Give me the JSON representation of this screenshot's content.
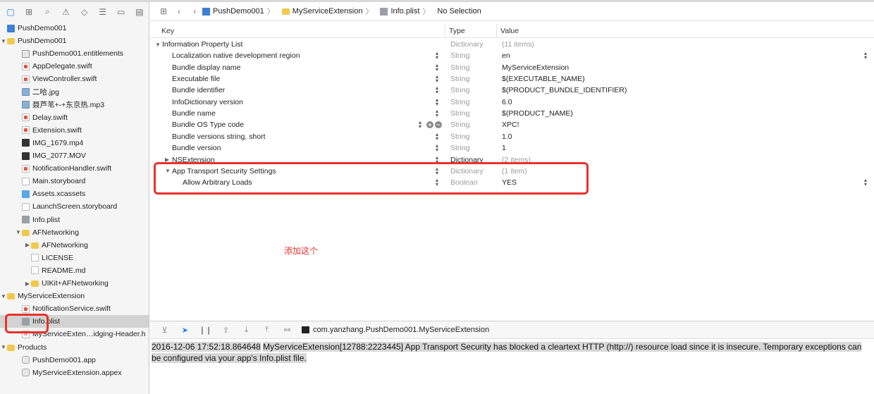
{
  "sidebar": {
    "items": [
      {
        "label": "PushDemo001",
        "icon": "project-icon",
        "depth": 0,
        "disclosure": ""
      },
      {
        "label": "PushDemo001",
        "icon": "folder-icon",
        "depth": 0,
        "disclosure": "▼"
      },
      {
        "label": "PushDemo001.entitlements",
        "icon": "entitlements-icon",
        "depth": 1,
        "disclosure": ""
      },
      {
        "label": "AppDelegate.swift",
        "icon": "swift-file-icon",
        "depth": 1,
        "disclosure": ""
      },
      {
        "label": "ViewController.swift",
        "icon": "swift-file-icon",
        "depth": 1,
        "disclosure": ""
      },
      {
        "label": "二哈.jpg",
        "icon": "image-file-icon",
        "depth": 1,
        "disclosure": ""
      },
      {
        "label": "聂芦苇+-+东京热.mp3",
        "icon": "audio-file-icon",
        "depth": 1,
        "disclosure": ""
      },
      {
        "label": "Delay.swift",
        "icon": "swift-file-icon",
        "depth": 1,
        "disclosure": ""
      },
      {
        "label": "Extension.swift",
        "icon": "swift-file-icon",
        "depth": 1,
        "disclosure": ""
      },
      {
        "label": "IMG_1679.mp4",
        "icon": "video-file-icon",
        "depth": 1,
        "disclosure": ""
      },
      {
        "label": "IMG_2077.MOV",
        "icon": "video-file-icon",
        "depth": 1,
        "disclosure": ""
      },
      {
        "label": "NotificationHandler.swift",
        "icon": "swift-file-icon",
        "depth": 1,
        "disclosure": ""
      },
      {
        "label": "Main.storyboard",
        "icon": "storyboard-icon",
        "depth": 1,
        "disclosure": ""
      },
      {
        "label": "Assets.xcassets",
        "icon": "assets-icon",
        "depth": 1,
        "disclosure": ""
      },
      {
        "label": "LaunchScreen.storyboard",
        "icon": "storyboard-icon",
        "depth": 1,
        "disclosure": ""
      },
      {
        "label": "Info.plist",
        "icon": "plist-icon",
        "depth": 1,
        "disclosure": ""
      },
      {
        "label": "AFNetworking",
        "icon": "folder-icon",
        "depth": 1,
        "disclosure": "▼"
      },
      {
        "label": "AFNetworking",
        "icon": "folder-icon",
        "depth": 2,
        "disclosure": "▶"
      },
      {
        "label": "LICENSE",
        "icon": "document-icon",
        "depth": 2,
        "disclosure": ""
      },
      {
        "label": "README.md",
        "icon": "document-icon",
        "depth": 2,
        "disclosure": ""
      },
      {
        "label": "UIKit+AFNetworking",
        "icon": "folder-icon",
        "depth": 2,
        "disclosure": "▶"
      },
      {
        "label": "MyServiceExtension",
        "icon": "folder-icon",
        "depth": 0,
        "disclosure": "▼"
      },
      {
        "label": "NotificationService.swift",
        "icon": "swift-file-icon",
        "depth": 1,
        "disclosure": ""
      },
      {
        "label": "Info.plist",
        "icon": "plist-icon",
        "depth": 1,
        "disclosure": "",
        "selected": true
      },
      {
        "label": "MyServiceExten…idging-Header.h",
        "icon": "header-file-icon",
        "depth": 1,
        "disclosure": ""
      },
      {
        "label": "Products",
        "icon": "folder-icon",
        "depth": 0,
        "disclosure": "▼"
      },
      {
        "label": "PushDemo001.app",
        "icon": "app-icon",
        "depth": 1,
        "disclosure": ""
      },
      {
        "label": "MyServiceExtension.appex",
        "icon": "appex-icon",
        "depth": 1,
        "disclosure": ""
      }
    ]
  },
  "jumpbar": {
    "crumbs": [
      "PushDemo001",
      "MyServiceExtension",
      "Info.plist",
      "No Selection"
    ]
  },
  "plist": {
    "headers": {
      "key": "Key",
      "type": "Type",
      "value": "Value"
    },
    "rows": [
      {
        "key": "Information Property List",
        "type": "Dictionary",
        "value": "(11 items)",
        "depth": 0,
        "disclosure": "▼",
        "value_grey": true,
        "type_dark": false
      },
      {
        "key": "Localization native development region",
        "type": "String",
        "value": "en",
        "depth": 1,
        "disclosure": "",
        "value_grey": false,
        "type_dark": false
      },
      {
        "key": "Bundle display name",
        "type": "String",
        "value": "MyServiceExtension",
        "depth": 1,
        "disclosure": "",
        "value_grey": false,
        "type_dark": false
      },
      {
        "key": "Executable file",
        "type": "String",
        "value": "$(EXECUTABLE_NAME)",
        "depth": 1,
        "disclosure": "",
        "value_grey": false,
        "type_dark": false
      },
      {
        "key": "Bundle identifier",
        "type": "String",
        "value": "$(PRODUCT_BUNDLE_IDENTIFIER)",
        "depth": 1,
        "disclosure": "",
        "value_grey": false,
        "type_dark": false
      },
      {
        "key": "InfoDictionary version",
        "type": "String",
        "value": "6.0",
        "depth": 1,
        "disclosure": "",
        "value_grey": false,
        "type_dark": false
      },
      {
        "key": "Bundle name",
        "type": "String",
        "value": "$(PRODUCT_NAME)",
        "depth": 1,
        "disclosure": "",
        "value_grey": false,
        "type_dark": false
      },
      {
        "key": "Bundle OS Type code",
        "type": "String",
        "value": "XPC!",
        "depth": 1,
        "disclosure": "",
        "value_grey": false,
        "type_dark": false
      },
      {
        "key": "Bundle versions string, short",
        "type": "String",
        "value": "1.0",
        "depth": 1,
        "disclosure": "",
        "value_grey": false,
        "type_dark": false
      },
      {
        "key": "Bundle version",
        "type": "String",
        "value": "1",
        "depth": 1,
        "disclosure": "",
        "value_grey": false,
        "type_dark": false
      },
      {
        "key": "NSExtension",
        "type": "Dictionary",
        "value": "(2 items)",
        "depth": 1,
        "disclosure": "▶",
        "value_grey": true,
        "type_dark": true
      },
      {
        "key": "App Transport Security Settings",
        "type": "Dictionary",
        "value": "(1 item)",
        "depth": 1,
        "disclosure": "▼",
        "value_grey": true,
        "type_dark": false
      },
      {
        "key": "Allow Arbitrary Loads",
        "type": "Boolean",
        "value": "YES",
        "depth": 2,
        "disclosure": "",
        "value_grey": false,
        "type_dark": false
      }
    ]
  },
  "annotation": {
    "text": "添加这个",
    "color": "#e8322f"
  },
  "debug": {
    "scheme": "com.yanzhang.PushDemo001.MyServiceExtension",
    "log_timestamp": "2016-12-06 17:52:18.864648",
    "log_message": "MyServiceExtension[12788:2223445] App Transport Security has blocked a cleartext HTTP (http://) resource load since it is insecure. Temporary exceptions can be configured via your app's Info.plist file."
  },
  "colors": {
    "accent": "#1a7bf2",
    "highlight": "#e8322f",
    "folder": "#f2c94c"
  }
}
